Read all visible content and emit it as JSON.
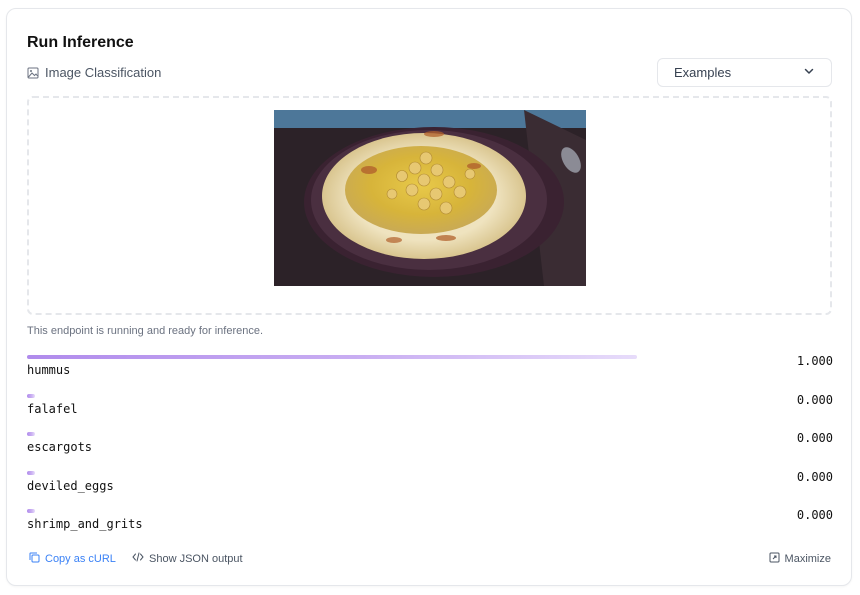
{
  "header": {
    "title": "Run Inference",
    "task": "Image Classification"
  },
  "examples": {
    "label": "Examples"
  },
  "status": "This endpoint is running and ready for inference.",
  "results": [
    {
      "label": "hummus",
      "score_text": "1.000",
      "score": 1.0
    },
    {
      "label": "falafel",
      "score_text": "0.000",
      "score": 0.0
    },
    {
      "label": "escargots",
      "score_text": "0.000",
      "score": 0.0
    },
    {
      "label": "deviled_eggs",
      "score_text": "0.000",
      "score": 0.0
    },
    {
      "label": "shrimp_and_grits",
      "score_text": "0.000",
      "score": 0.0
    }
  ],
  "footer": {
    "copy_curl": "Copy as cURL",
    "show_json": "Show JSON output",
    "maximize": "Maximize"
  },
  "colors": {
    "accent_bar": "#b08bec",
    "link": "#3b82f6"
  }
}
